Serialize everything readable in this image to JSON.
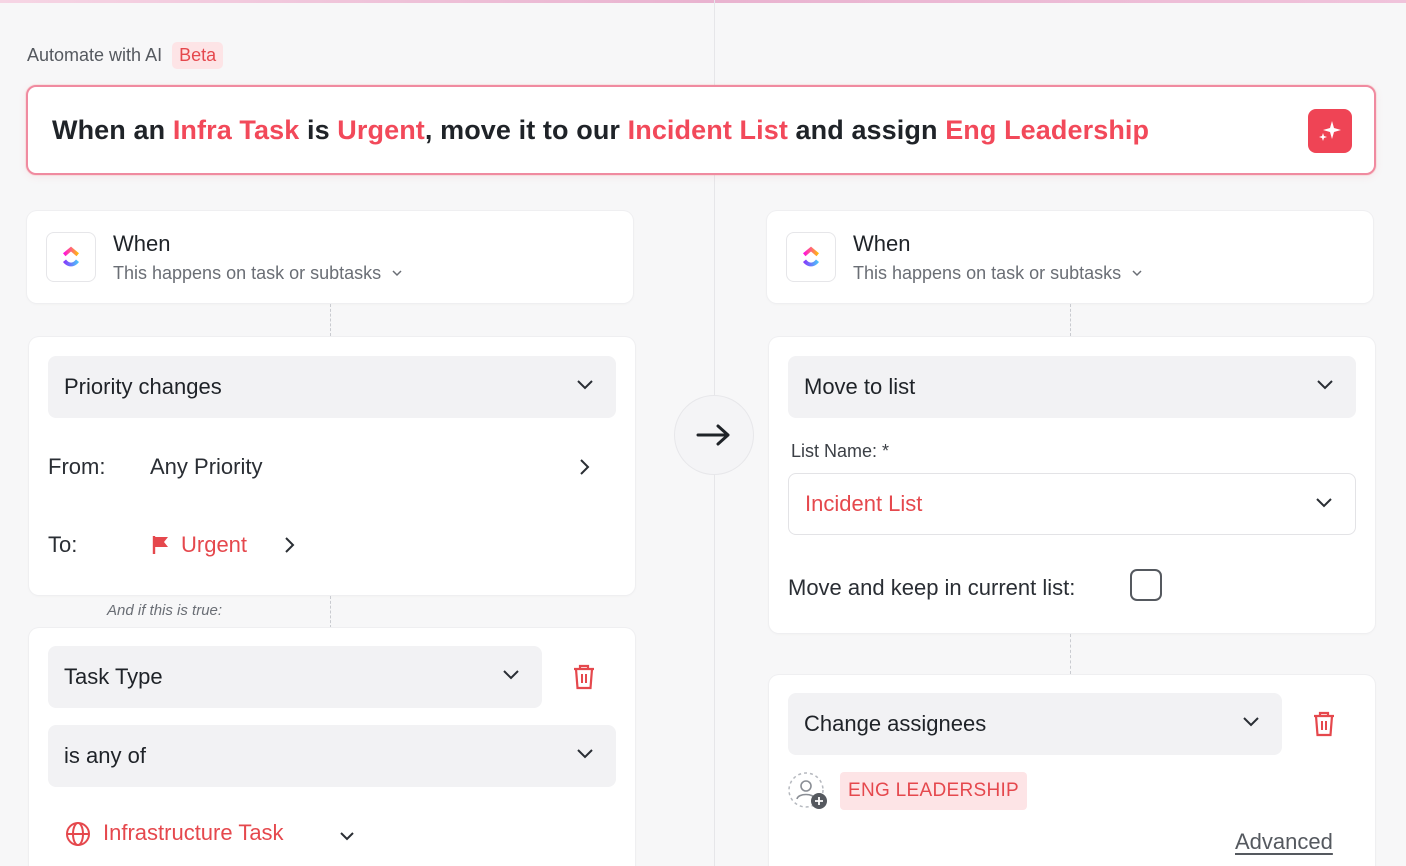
{
  "header": {
    "title": "Automate with AI",
    "badge": "Beta"
  },
  "prompt": {
    "parts": [
      {
        "text": "When an ",
        "highlight": false
      },
      {
        "text": "Infra Task",
        "highlight": true
      },
      {
        "text": " is ",
        "highlight": false
      },
      {
        "text": "Urgent",
        "highlight": true
      },
      {
        "text": ", move it to our ",
        "highlight": false
      },
      {
        "text": "Incident List",
        "highlight": true
      },
      {
        "text": " and assign ",
        "highlight": false
      },
      {
        "text": "Eng Leadership",
        "highlight": true
      }
    ],
    "button_icon": "sparkle-icon"
  },
  "left": {
    "trigger": {
      "title": "When",
      "subtitle": "This happens on task or subtasks"
    },
    "event": {
      "select": "Priority changes",
      "from_label": "From:",
      "from_value": "Any Priority",
      "to_label": "To:",
      "to_value": "Urgent"
    },
    "condition_label": "And if this is true:",
    "condition": {
      "field": "Task Type",
      "operator": "is any of",
      "value": "Infrastructure Task"
    }
  },
  "right": {
    "trigger": {
      "title": "When",
      "subtitle": "This happens on task or subtasks"
    },
    "action1": {
      "select": "Move to list",
      "list_name_label": "List Name: *",
      "list_value": "Incident List",
      "keep_label": "Move and keep in current list:"
    },
    "action2": {
      "select": "Change assignees",
      "assignee": "ENG LEADERSHIP",
      "advanced": "Advanced"
    }
  },
  "colors": {
    "accent": "#e5484d",
    "prompt_border": "#f08aa0",
    "button": "#ef4455"
  }
}
